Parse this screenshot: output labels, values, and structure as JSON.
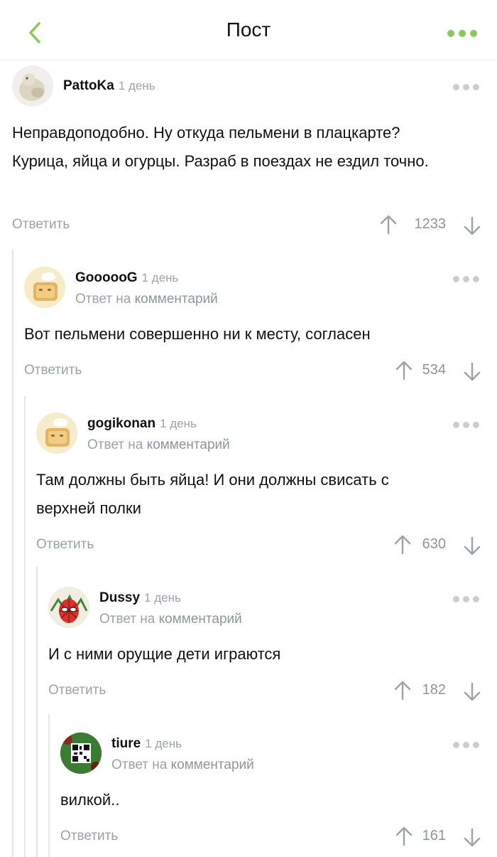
{
  "header": {
    "title": "Пост"
  },
  "colors": {
    "accent": "#8ac858",
    "muted": "#9aa3a9",
    "thread_line": "#e2e6e9"
  },
  "comments": [
    {
      "username": "PattoKa",
      "time": "1 день",
      "avatar": "photo-avatar",
      "text": "Неправдоподобно. Ну откуда пельмени в плацкарте? Курица, яйца и огурцы. Разраб в поездах не ездил точно.",
      "reply_label": "Ответить",
      "votes": "1233"
    },
    {
      "username": "GoooooG",
      "time": "1 день",
      "avatar": "default-toast-avatar",
      "reply_to_prefix": "Ответ на",
      "reply_to_link": "комментарий",
      "text": "Вот пельмени совершенно ни к месту, согласен",
      "reply_label": "Ответить",
      "votes": "534"
    },
    {
      "username": "gogikonan",
      "time": "1 день",
      "avatar": "default-toast-avatar",
      "reply_to_prefix": "Ответ на",
      "reply_to_link": "комментарий",
      "text": "Там должны быть яйца! И они должны свисать с верхней полки",
      "reply_label": "Ответить",
      "votes": "630"
    },
    {
      "username": "Dussy",
      "time": "1 день",
      "avatar": "spiderman-avatar",
      "reply_to_prefix": "Ответ на",
      "reply_to_link": "комментарий",
      "text": "И с ними орущие дети играются",
      "reply_label": "Ответить",
      "votes": "182"
    },
    {
      "username": "tiure",
      "time": "1 день",
      "avatar": "qr-code-avatar",
      "reply_to_prefix": "Ответ на",
      "reply_to_link": "комментарий",
      "text": "вилкой..",
      "reply_label": "Ответить",
      "votes": "161"
    }
  ]
}
